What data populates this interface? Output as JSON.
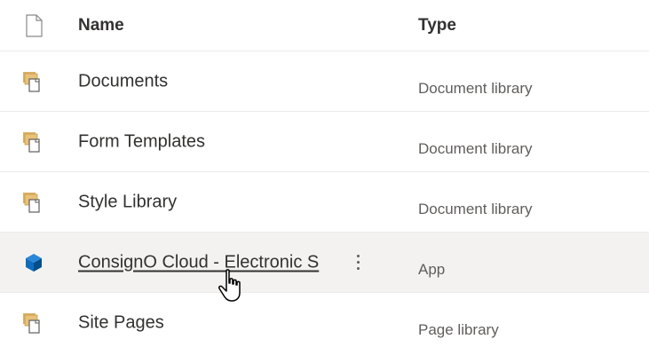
{
  "header": {
    "name_label": "Name",
    "type_label": "Type",
    "file_icon": "document-icon"
  },
  "rows": [
    {
      "name": "Documents",
      "type": "Document library",
      "icon": "document-library-icon"
    },
    {
      "name": "Form Templates",
      "type": "Document library",
      "icon": "document-library-icon"
    },
    {
      "name": "Style Library",
      "type": "Document library",
      "icon": "document-library-icon"
    },
    {
      "name": "ConsignO Cloud - Electronic S",
      "type": "App",
      "icon": "app-cube-icon",
      "hovered": true
    },
    {
      "name": "Site Pages",
      "type": "Page library",
      "icon": "document-library-icon"
    }
  ],
  "colors": {
    "library_icon": "#dcb067",
    "app_icon": "#0f6cbd",
    "hover_bg": "#f3f2f1"
  }
}
